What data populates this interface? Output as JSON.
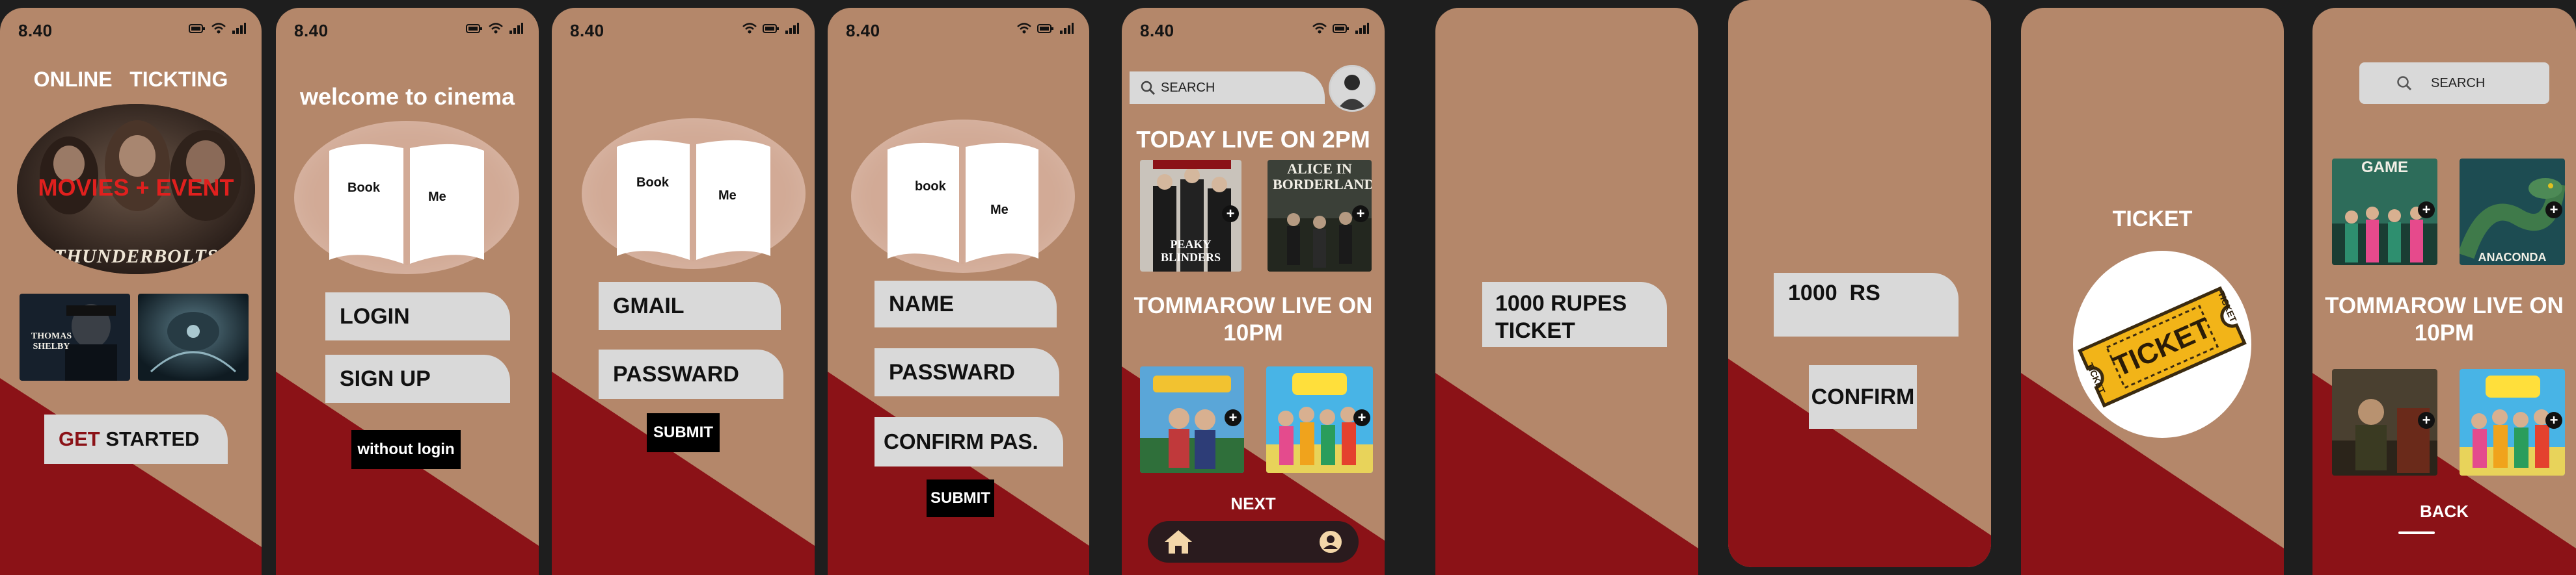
{
  "status": {
    "time": "8.40"
  },
  "screen1": {
    "title": "ONLINE   TICKTING",
    "hero_text": "MOVIES + EVENT",
    "hero_logo": "THUNDERBOLTS",
    "poster1_name": "THOMAS SHELBY",
    "get_started_prefix": "GET",
    "get_started_rest": " STARTED"
  },
  "screen2": {
    "title": "welcome to cinema",
    "book_left": "Book",
    "book_right": "Me",
    "login": "LOGIN",
    "signup": "SIGN UP",
    "without_login": "without login"
  },
  "screen3": {
    "book_left": "Book",
    "book_right": "Me",
    "gmail": "GMAIL",
    "password": "PASSWARD",
    "submit": "SUBMIT"
  },
  "screen4": {
    "book_left": "book",
    "book_right": "Me",
    "name": "NAME",
    "password": "PASSWARD",
    "confirm": "CONFIRM PAS.",
    "submit": "SUBMIT"
  },
  "screen5": {
    "search_placeholder": "SEARCH",
    "today_heading": "TODAY LIVE ON 2PM",
    "poster_peaky": "PEAKY BLINDERS",
    "poster_alice": "ALICE IN BORDERLAND",
    "tomorrow_heading_line1": "TOMMAROW LIVE ON",
    "tomorrow_heading_line2": "10PM",
    "next": "NEXT"
  },
  "screen6": {
    "ticket_line1": "1000 RUPES",
    "ticket_line2": "TICKET"
  },
  "screen7": {
    "amount": "1000  RS",
    "confirm": "CONFIRM"
  },
  "screen8": {
    "title": "TICKET",
    "ticket_word": "TICKET",
    "side_left": "TICKET",
    "side_right": "TICKET"
  },
  "screen9": {
    "search_placeholder": "SEARCH",
    "poster_game": "GAME",
    "poster_anaconda": "ANACONDA",
    "tomorrow_heading_line1": "TOMMAROW LIVE ON",
    "tomorrow_heading_line2": "10PM",
    "back": "BACK"
  },
  "colors": {
    "background": "#1e1e1e",
    "tan": "#b4876a",
    "maroon": "#8b1217",
    "pill": "#d9d9d9",
    "ticket_gold": "#f2b418"
  }
}
